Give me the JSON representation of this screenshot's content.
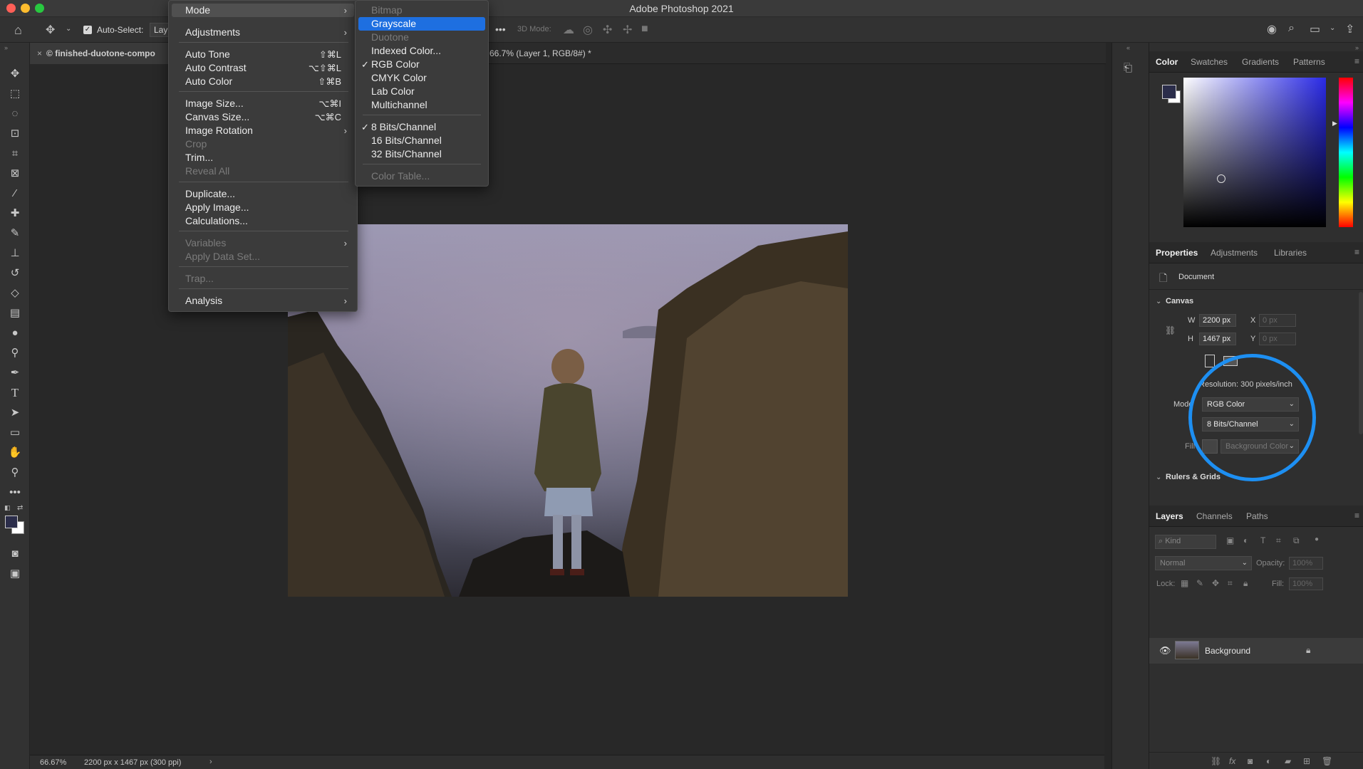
{
  "app": {
    "title": "Adobe Photoshop 2021"
  },
  "options_bar": {
    "auto_select_label": "Auto-Select:",
    "auto_select_value": "Lay",
    "three_d_mode_label": "3D Mode:",
    "more": "•••"
  },
  "document": {
    "tab_name": "© finished-duotone-compo",
    "tab_info": "66.7% (Layer 1, RGB/8#) *",
    "zoom": "66.67%",
    "size_info": "2200 px x 1467 px (300 ppi)"
  },
  "image_menu": {
    "items": [
      {
        "label": "Mode",
        "shortcut": "",
        "submenu": true,
        "disabled": false,
        "highlight": true
      },
      {
        "label": "Adjustments",
        "shortcut": "",
        "submenu": true,
        "disabled": false
      },
      {
        "label": "Auto Tone",
        "shortcut": "⇧⌘L",
        "submenu": false,
        "disabled": false
      },
      {
        "label": "Auto Contrast",
        "shortcut": "⌥⇧⌘L",
        "submenu": false,
        "disabled": false
      },
      {
        "label": "Auto Color",
        "shortcut": "⇧⌘B",
        "submenu": false,
        "disabled": false
      },
      {
        "label": "Image Size...",
        "shortcut": "⌥⌘I",
        "submenu": false,
        "disabled": false
      },
      {
        "label": "Canvas Size...",
        "shortcut": "⌥⌘C",
        "submenu": false,
        "disabled": false
      },
      {
        "label": "Image Rotation",
        "shortcut": "",
        "submenu": true,
        "disabled": false
      },
      {
        "label": "Crop",
        "shortcut": "",
        "submenu": false,
        "disabled": true
      },
      {
        "label": "Trim...",
        "shortcut": "",
        "submenu": false,
        "disabled": false
      },
      {
        "label": "Reveal All",
        "shortcut": "",
        "submenu": false,
        "disabled": true
      },
      {
        "label": "Duplicate...",
        "shortcut": "",
        "submenu": false,
        "disabled": false
      },
      {
        "label": "Apply Image...",
        "shortcut": "",
        "submenu": false,
        "disabled": false
      },
      {
        "label": "Calculations...",
        "shortcut": "",
        "submenu": false,
        "disabled": false
      },
      {
        "label": "Variables",
        "shortcut": "",
        "submenu": true,
        "disabled": true
      },
      {
        "label": "Apply Data Set...",
        "shortcut": "",
        "submenu": false,
        "disabled": true
      },
      {
        "label": "Trap...",
        "shortcut": "",
        "submenu": false,
        "disabled": true
      },
      {
        "label": "Analysis",
        "shortcut": "",
        "submenu": true,
        "disabled": false
      }
    ]
  },
  "mode_submenu": {
    "items": [
      {
        "label": "Bitmap",
        "disabled": true,
        "checked": false,
        "selected": false
      },
      {
        "label": "Grayscale",
        "disabled": false,
        "checked": false,
        "selected": true
      },
      {
        "label": "Duotone",
        "disabled": true,
        "checked": false,
        "selected": false
      },
      {
        "label": "Indexed Color...",
        "disabled": false,
        "checked": false,
        "selected": false
      },
      {
        "label": "RGB Color",
        "disabled": false,
        "checked": true,
        "selected": false
      },
      {
        "label": "CMYK Color",
        "disabled": false,
        "checked": false,
        "selected": false
      },
      {
        "label": "Lab Color",
        "disabled": false,
        "checked": false,
        "selected": false
      },
      {
        "label": "Multichannel",
        "disabled": false,
        "checked": false,
        "selected": false
      },
      {
        "label": "8 Bits/Channel",
        "disabled": false,
        "checked": true,
        "selected": false
      },
      {
        "label": "16 Bits/Channel",
        "disabled": false,
        "checked": false,
        "selected": false
      },
      {
        "label": "32 Bits/Channel",
        "disabled": false,
        "checked": false,
        "selected": false
      },
      {
        "label": "Color Table...",
        "disabled": true,
        "checked": false,
        "selected": false
      }
    ],
    "check_glyph": "✓"
  },
  "color_panel": {
    "tabs": [
      "Color",
      "Swatches",
      "Gradients",
      "Patterns"
    ],
    "active_tab": "Color"
  },
  "properties_panel": {
    "tabs": [
      "Properties",
      "Adjustments",
      "Libraries"
    ],
    "document_label": "Document",
    "canvas_section": "Canvas",
    "w_label": "W",
    "w_value": "2200 px",
    "h_label": "H",
    "h_value": "1467 px",
    "x_label": "X",
    "x_value": "0 px",
    "y_label": "Y",
    "y_value": "0 px",
    "resolution": "Resolution: 300 pixels/inch",
    "mode_label": "Mode",
    "mode_value": "RGB Color",
    "bits_value": "8 Bits/Channel",
    "fill_label": "Fill",
    "fill_value": "Background Color",
    "rulers_section": "Rulers & Grids"
  },
  "layers_panel": {
    "tabs": [
      "Layers",
      "Channels",
      "Paths"
    ],
    "kind_placeholder": "Kind",
    "blend_mode": "Normal",
    "opacity_label": "Opacity:",
    "opacity_value": "100%",
    "lock_label": "Lock:",
    "fill_label": "Fill:",
    "fill_value": "100%",
    "layers": [
      {
        "name": "Background",
        "visible": true,
        "locked": true
      }
    ]
  },
  "colors": {
    "accent_blue": "#1e6fe0",
    "highlight_circle": "#1d8ff2",
    "foreground": "#2b2d4a",
    "background": "#ffffff"
  }
}
